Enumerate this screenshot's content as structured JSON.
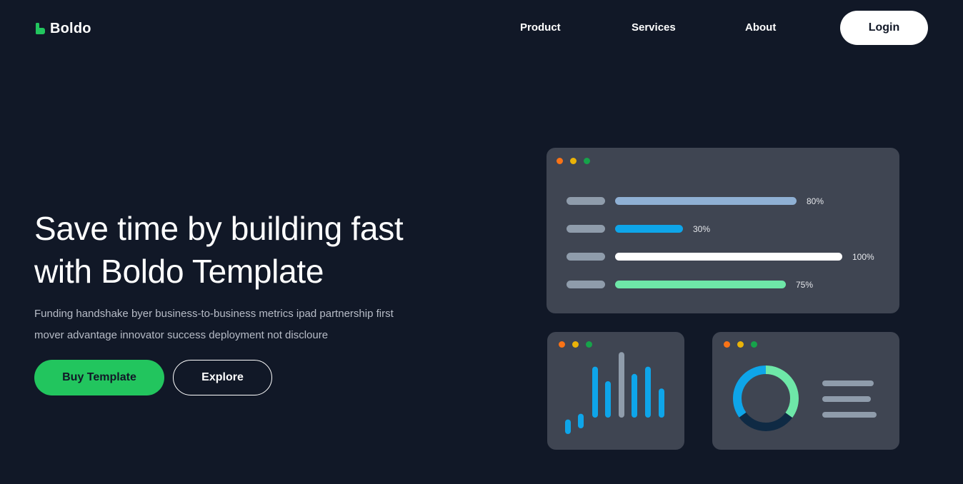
{
  "brand": {
    "name": "Boldo",
    "accent": "#22c55e",
    "icon": "boldo-b-logo-icon"
  },
  "nav": {
    "items": [
      {
        "label": "Product"
      },
      {
        "label": "Services"
      },
      {
        "label": "About"
      }
    ],
    "login_label": "Login"
  },
  "hero": {
    "title_line1": "Save time by building fast",
    "title_line2": "with Boldo Template",
    "subtitle_line1": "Funding handshake byer business-to-business metrics ipad partnership first",
    "subtitle_line2": "mover advantage innovator success deployment not discloure",
    "primary_button": "Buy Template",
    "secondary_button": "Explore"
  },
  "illustration": {
    "window_dot_colors": [
      "#f97316",
      "#eab308",
      "#16a34a"
    ],
    "progress": [
      {
        "value": 80,
        "label": "80%",
        "color": "#8fb0d4"
      },
      {
        "value": 30,
        "label": "30%",
        "color": "#0ea5e9"
      },
      {
        "value": 100,
        "label": "100%",
        "color": "#ffffff"
      },
      {
        "value": 75,
        "label": "75%",
        "color": "#6ee7a8"
      }
    ],
    "bar_chart": {
      "values": [
        2,
        2,
        7,
        5,
        9,
        6,
        7,
        4
      ],
      "colors": [
        "#0ea5e9",
        "#0ea5e9",
        "#0ea5e9",
        "#0ea5e9",
        "#8f9cab",
        "#0ea5e9",
        "#0ea5e9",
        "#0ea5e9"
      ]
    },
    "donut": {
      "segments": [
        {
          "value": 35,
          "color": "#6ee7a8"
        },
        {
          "value": 30,
          "color": "#0f2a44"
        },
        {
          "value": 35,
          "color": "#0ea5e9"
        }
      ]
    },
    "legend_line_count": 3
  }
}
